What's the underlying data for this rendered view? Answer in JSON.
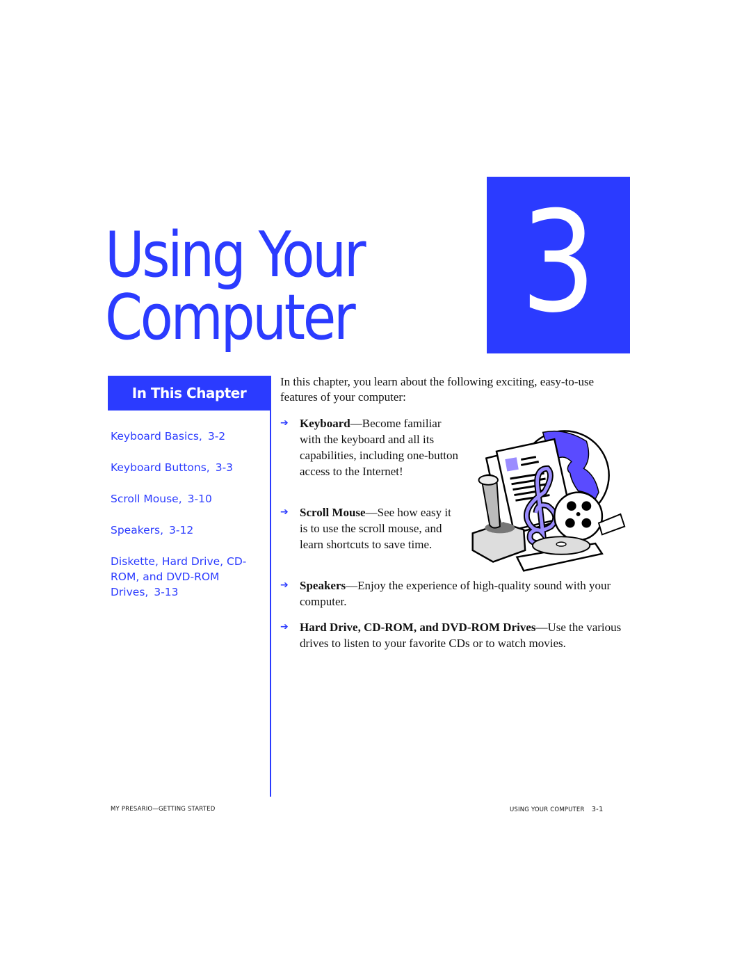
{
  "chapter": {
    "title_line1": "Using Your",
    "title_line2": "Computer",
    "number": "3",
    "accent_color": "#2b3bff"
  },
  "sidebar": {
    "header": "In This Chapter",
    "items": [
      {
        "label": "Keyboard Basics,",
        "page": "3-2"
      },
      {
        "label": "Keyboard Buttons,",
        "page": "3-3"
      },
      {
        "label": "Scroll Mouse,",
        "page": "3-10"
      },
      {
        "label": "Speakers,",
        "page": "3-12"
      },
      {
        "label": "Diskette, Hard Drive, CD-ROM, and DVD-ROM Drives,",
        "page": "3-13"
      }
    ]
  },
  "main": {
    "intro": "In this chapter, you learn about the following exciting, easy-to-use features of your computer:",
    "bullet_icon": "right-arrow-icon",
    "bullets": [
      {
        "term": "Keyboard",
        "desc": "—Become familiar with the keyboard and all its capabilities, including one-button access to the Internet!"
      },
      {
        "term": "Scroll Mouse",
        "desc": "—See how easy it is to use the scroll mouse, and learn shortcuts to save time."
      },
      {
        "term": "Speakers",
        "desc": "—Enjoy the experience of high-quality sound with your computer."
      },
      {
        "term": "Hard Drive, CD-ROM, and DVD-ROM Drives",
        "desc": "—Use the various drives to listen to your favorite CDs or to watch movies."
      }
    ],
    "clipart": "multimedia-clipart"
  },
  "footer": {
    "left": "My Presario—Getting Started",
    "right_title": "Using Your Computer",
    "right_page": "3-1"
  }
}
